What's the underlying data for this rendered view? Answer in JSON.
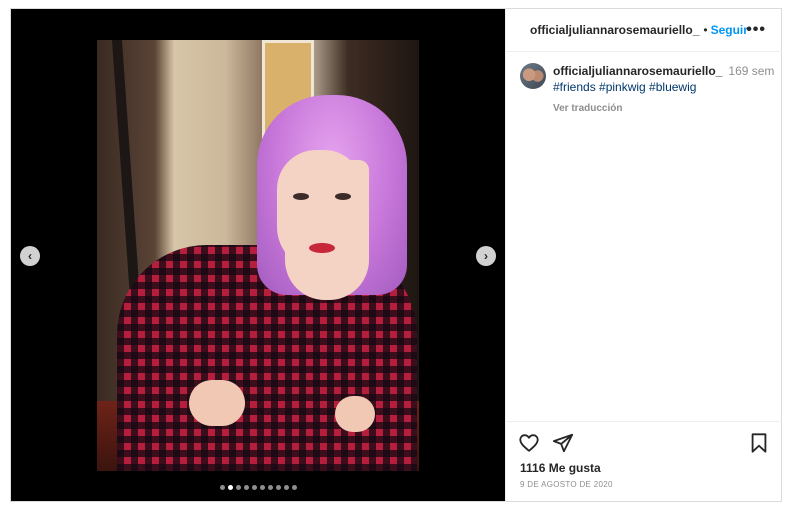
{
  "post": {
    "username": "officialjuliannarosemauriello_",
    "separator": "•",
    "follow_label": "Seguir",
    "more_label": "•••",
    "caption": {
      "username": "officialjuliannarosemauriello_",
      "time_ago": "169 sem",
      "hashtags": "#friends #pinkwig #bluewig",
      "translate_label": "Ver traducción"
    },
    "likes": "1116 Me gusta",
    "date": "9 DE AGOSTO DE 2020"
  },
  "carousel": {
    "prev_label": "‹",
    "next_label": "›",
    "total_slides": 10,
    "active_slide": 2
  },
  "icons": {
    "like": "heart-icon",
    "share": "paper-plane-icon",
    "save": "bookmark-icon",
    "prev": "chevron-left-icon",
    "next": "chevron-right-icon"
  },
  "colors": {
    "link_blue": "#0095f6",
    "hashtag": "#00376b",
    "muted": "#8e8e8e",
    "text": "#262626",
    "media_bg": "#000000"
  }
}
